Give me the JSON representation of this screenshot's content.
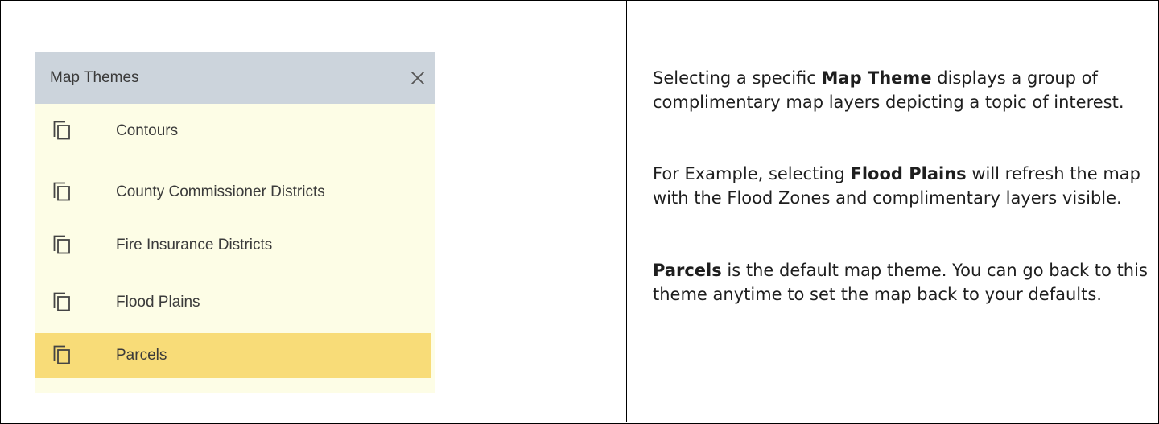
{
  "panel": {
    "title": "Map Themes",
    "close_icon": "close-icon",
    "item_icon": "copy-layers-icon",
    "items": [
      {
        "label": "Contours",
        "selected": false
      },
      {
        "label": "County Commissioner Districts",
        "selected": false
      },
      {
        "label": "Fire Insurance Districts",
        "selected": false
      },
      {
        "label": "Flood Plains",
        "selected": false
      },
      {
        "label": "Parcels",
        "selected": true
      }
    ],
    "colors": {
      "header_bg": "#ccd4dc",
      "list_bg": "#fdfde6",
      "selected_bg": "#f8dc78"
    }
  },
  "description": {
    "p1": {
      "before": "Selecting a specific ",
      "bold": "Map Theme",
      "after": " displays a group of complimentary map layers depicting a topic of interest."
    },
    "p2": {
      "before": "For Example, selecting ",
      "bold": "Flood Plains",
      "after": " will refresh the map with the Flood Zones and complimentary layers visible."
    },
    "p3": {
      "bold": "Parcels",
      "after": " is the default map theme. You can go back to this theme anytime to set the map back to your defaults."
    }
  }
}
